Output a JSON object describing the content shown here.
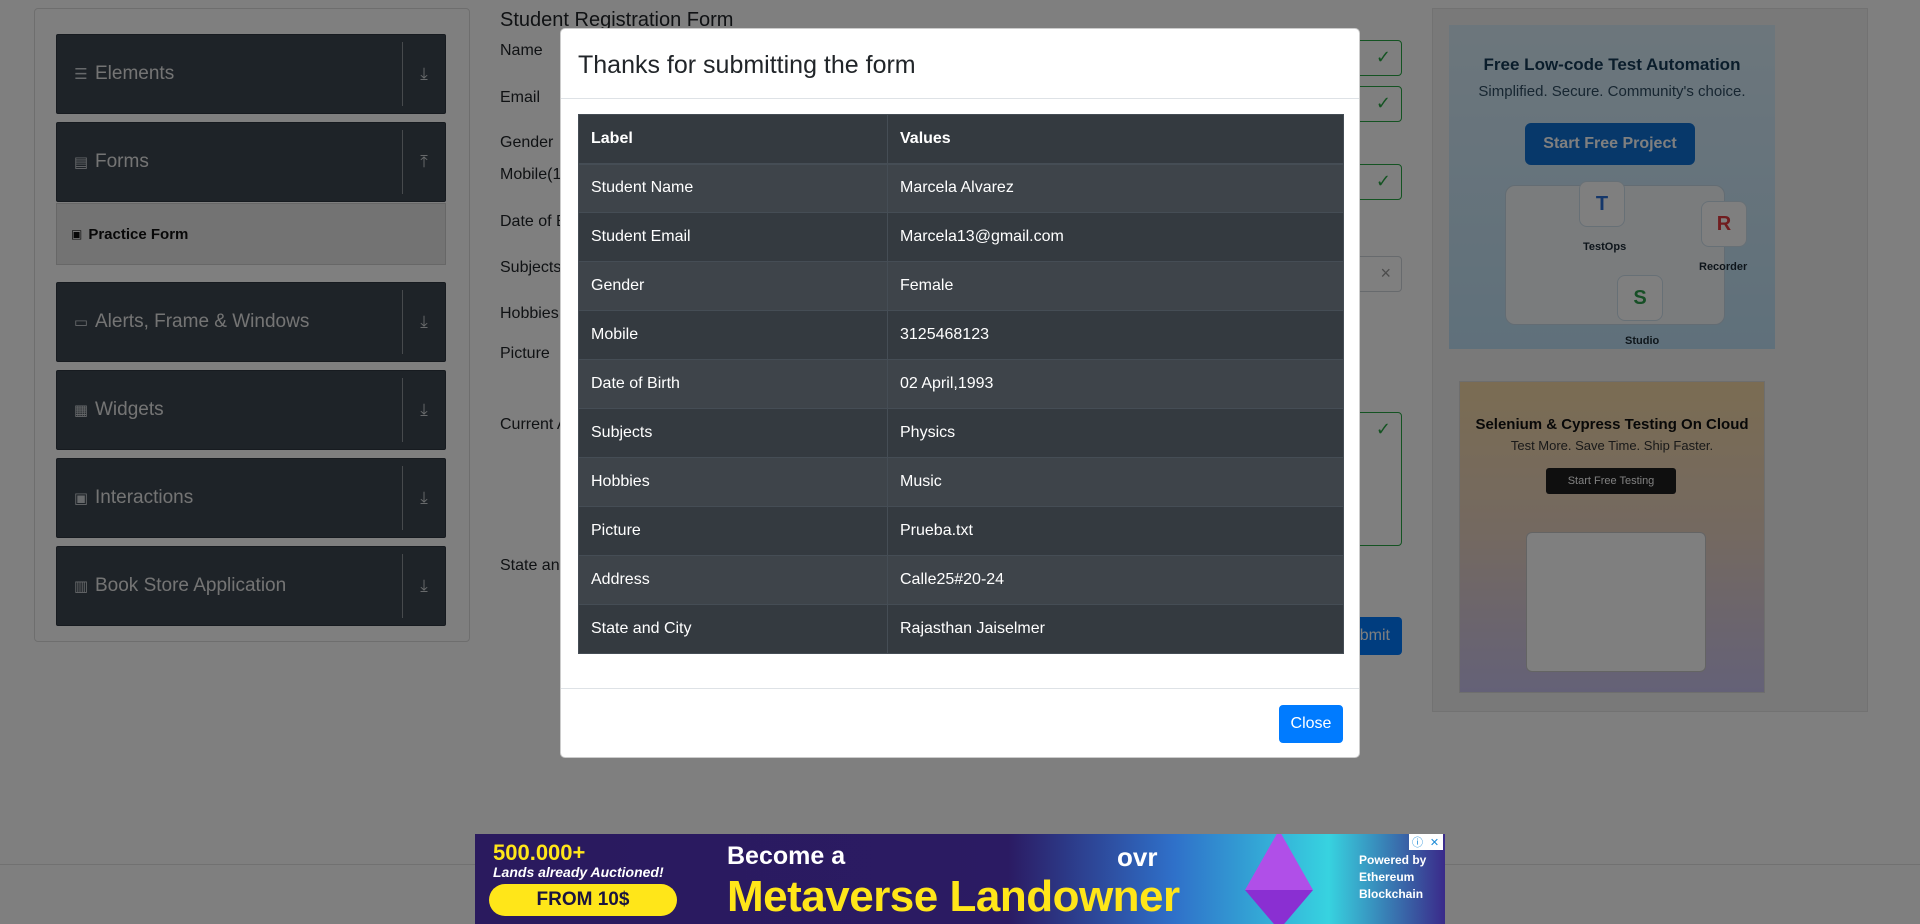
{
  "sidebar": {
    "groups": [
      {
        "label": "Elements",
        "icon": "menu-icon",
        "arrow": "⤓"
      },
      {
        "label": "Forms",
        "icon": "document-icon",
        "arrow": "⤒"
      },
      {
        "label": "Alerts, Frame & Windows",
        "icon": "window-icon",
        "arrow": "⤓"
      },
      {
        "label": "Widgets",
        "icon": "grid-icon",
        "arrow": "⤓"
      },
      {
        "label": "Interactions",
        "icon": "interaction-icon",
        "arrow": "⤓"
      },
      {
        "label": "Book Store Application",
        "icon": "books-icon",
        "arrow": "⤓"
      }
    ],
    "active_item": "Practice Form"
  },
  "form": {
    "title": "Student Registration Form",
    "labels": {
      "name": "Name",
      "email": "Email",
      "gender": "Gender",
      "mobile": "Mobile(1",
      "dob": "Date of B",
      "subjects": "Subjects",
      "hobbies": "Hobbies",
      "picture": "Picture",
      "current_address": "Current A",
      "state_city": "State and"
    },
    "submit_label": "bmit",
    "subjects_clear": "×"
  },
  "modal": {
    "title": "Thanks for submitting the form",
    "table": {
      "headers": [
        "Label",
        "Values"
      ],
      "rows": [
        [
          "Student Name",
          "Marcela Alvarez"
        ],
        [
          "Student Email",
          "Marcela13@gmail.com"
        ],
        [
          "Gender",
          "Female"
        ],
        [
          "Mobile",
          "3125468123"
        ],
        [
          "Date of Birth",
          "02 April,1993"
        ],
        [
          "Subjects",
          "Physics"
        ],
        [
          "Hobbies",
          "Music"
        ],
        [
          "Picture",
          "Prueba.txt"
        ],
        [
          "Address",
          "Calle25#20-24"
        ],
        [
          "State and City",
          "Rajasthan Jaiselmer"
        ]
      ]
    },
    "close_label": "Close"
  },
  "ads": {
    "katalon": {
      "title": "Free Low-code Test Automation",
      "subtitle": "Simplified. Secure. Community's choice.",
      "button": "Start Free Project",
      "tiles": {
        "testops": "TestOps",
        "recorder": "Recorder",
        "studio": "Studio"
      },
      "tile_letters": {
        "testops": "T",
        "recorder": "R",
        "studio": "S"
      }
    },
    "lambdatest": {
      "title": "Selenium & Cypress Testing On Cloud",
      "subtitle": "Test More. Save Time. Ship Faster.",
      "button": "Start Free Testing"
    },
    "banner": {
      "headline_number": "500.000+",
      "headline_text": "Lands already Auctioned!",
      "price_button": "FROM 10$",
      "become": "Become a",
      "metaverse": "Metaverse Landowner",
      "logo": "ovr",
      "powered_lines": [
        "Powered by",
        "Ethereum",
        "Blockchain"
      ]
    }
  },
  "colors": {
    "overlay": "rgba(0,0,0,0.5)",
    "primary": "#007bff",
    "success": "#28a745",
    "table_dark": "#343a40",
    "sidebar_dark": "#3d4750"
  }
}
